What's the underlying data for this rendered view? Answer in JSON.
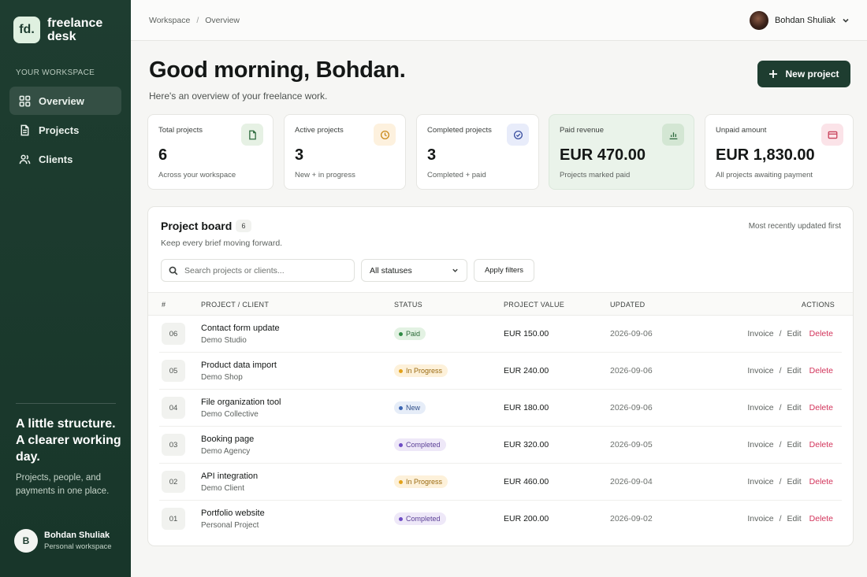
{
  "sidebar": {
    "logo_text": "fd.",
    "brand_name": "freelance desk",
    "section_heading": "YOUR WORKSPACE",
    "nav": [
      {
        "label": "Overview",
        "icon": "grid-icon",
        "active": true
      },
      {
        "label": "Projects",
        "icon": "document-icon",
        "active": false
      },
      {
        "label": "Clients",
        "icon": "users-icon",
        "active": false
      }
    ],
    "promo_title": "A little structure. A clearer working day.",
    "promo_text": "Projects, people, and payments in one place.",
    "user": {
      "initial": "B",
      "name": "Bohdan Shuliak",
      "subtitle": "Personal workspace"
    }
  },
  "topbar": {
    "breadcrumb": [
      "Workspace",
      "Overview"
    ],
    "user_name": "Bohdan Shuliak"
  },
  "header": {
    "greeting": "Good morning, Bohdan.",
    "subtitle": "Here's an overview of your freelance work.",
    "new_project_label": "New project"
  },
  "stats": [
    {
      "label": "Total projects",
      "value": "6",
      "sub": "Across your workspace",
      "icon": "document-icon",
      "icon_bg": "#e6f1e4",
      "icon_color": "#2e6b3e"
    },
    {
      "label": "Active projects",
      "value": "3",
      "sub": "New + in progress",
      "icon": "clock-icon",
      "icon_bg": "#fdf1de",
      "icon_color": "#c98a1a"
    },
    {
      "label": "Completed projects",
      "value": "3",
      "sub": "Completed + paid",
      "icon": "check-circle-icon",
      "icon_bg": "#e8ecfa",
      "icon_color": "#3a4fa0"
    },
    {
      "label": "Paid revenue",
      "value": "EUR 470.00",
      "sub": "Projects marked paid",
      "icon": "bar-chart-icon",
      "icon_bg": "#d3e6d3",
      "icon_color": "#2e6b3e"
    },
    {
      "label": "Unpaid amount",
      "value": "EUR 1,830.00",
      "sub": "All projects awaiting payment",
      "icon": "card-icon",
      "icon_bg": "#fbe3e8",
      "icon_color": "#c9435d"
    }
  ],
  "board": {
    "title": "Project board",
    "count": "6",
    "subtitle": "Keep every brief moving forward.",
    "sort_label": "Most recently updated first",
    "search_placeholder": "Search projects or clients...",
    "status_filter": "All statuses",
    "apply_label": "Apply filters",
    "columns": {
      "num": "#",
      "project": "PROJECT / CLIENT",
      "status": "STATUS",
      "value": "PROJECT VALUE",
      "updated": "UPDATED",
      "actions": "ACTIONS"
    },
    "actions": {
      "invoice": "Invoice",
      "sep": "/",
      "edit": "Edit",
      "delete": "Delete"
    },
    "rows": [
      {
        "num": "06",
        "title": "Contact form update",
        "client": "Demo Studio",
        "status": "Paid",
        "value": "EUR 150.00",
        "updated": "2026-09-06"
      },
      {
        "num": "05",
        "title": "Product data import",
        "client": "Demo Shop",
        "status": "In Progress",
        "value": "EUR 240.00",
        "updated": "2026-09-06"
      },
      {
        "num": "04",
        "title": "File organization tool",
        "client": "Demo Collective",
        "status": "New",
        "value": "EUR 180.00",
        "updated": "2026-09-06"
      },
      {
        "num": "03",
        "title": "Booking page",
        "client": "Demo Agency",
        "status": "Completed",
        "value": "EUR 320.00",
        "updated": "2026-09-05"
      },
      {
        "num": "02",
        "title": "API integration",
        "client": "Demo Client",
        "status": "In Progress",
        "value": "EUR 460.00",
        "updated": "2026-09-04"
      },
      {
        "num": "01",
        "title": "Portfolio website",
        "client": "Personal Project",
        "status": "Completed",
        "value": "EUR 200.00",
        "updated": "2026-09-02"
      }
    ],
    "status_colors": {
      "Paid": {
        "bg": "#e3f2e3",
        "fg": "#2a6a36",
        "dot": "#2f8a44"
      },
      "In Progress": {
        "bg": "#fdf1da",
        "fg": "#9a6a10",
        "dot": "#e3a21a"
      },
      "New": {
        "bg": "#e6edf8",
        "fg": "#2f4f8a",
        "dot": "#3c66b3"
      },
      "Completed": {
        "bg": "#eee8f8",
        "fg": "#5a3f96",
        "dot": "#6e4cc4"
      }
    }
  }
}
